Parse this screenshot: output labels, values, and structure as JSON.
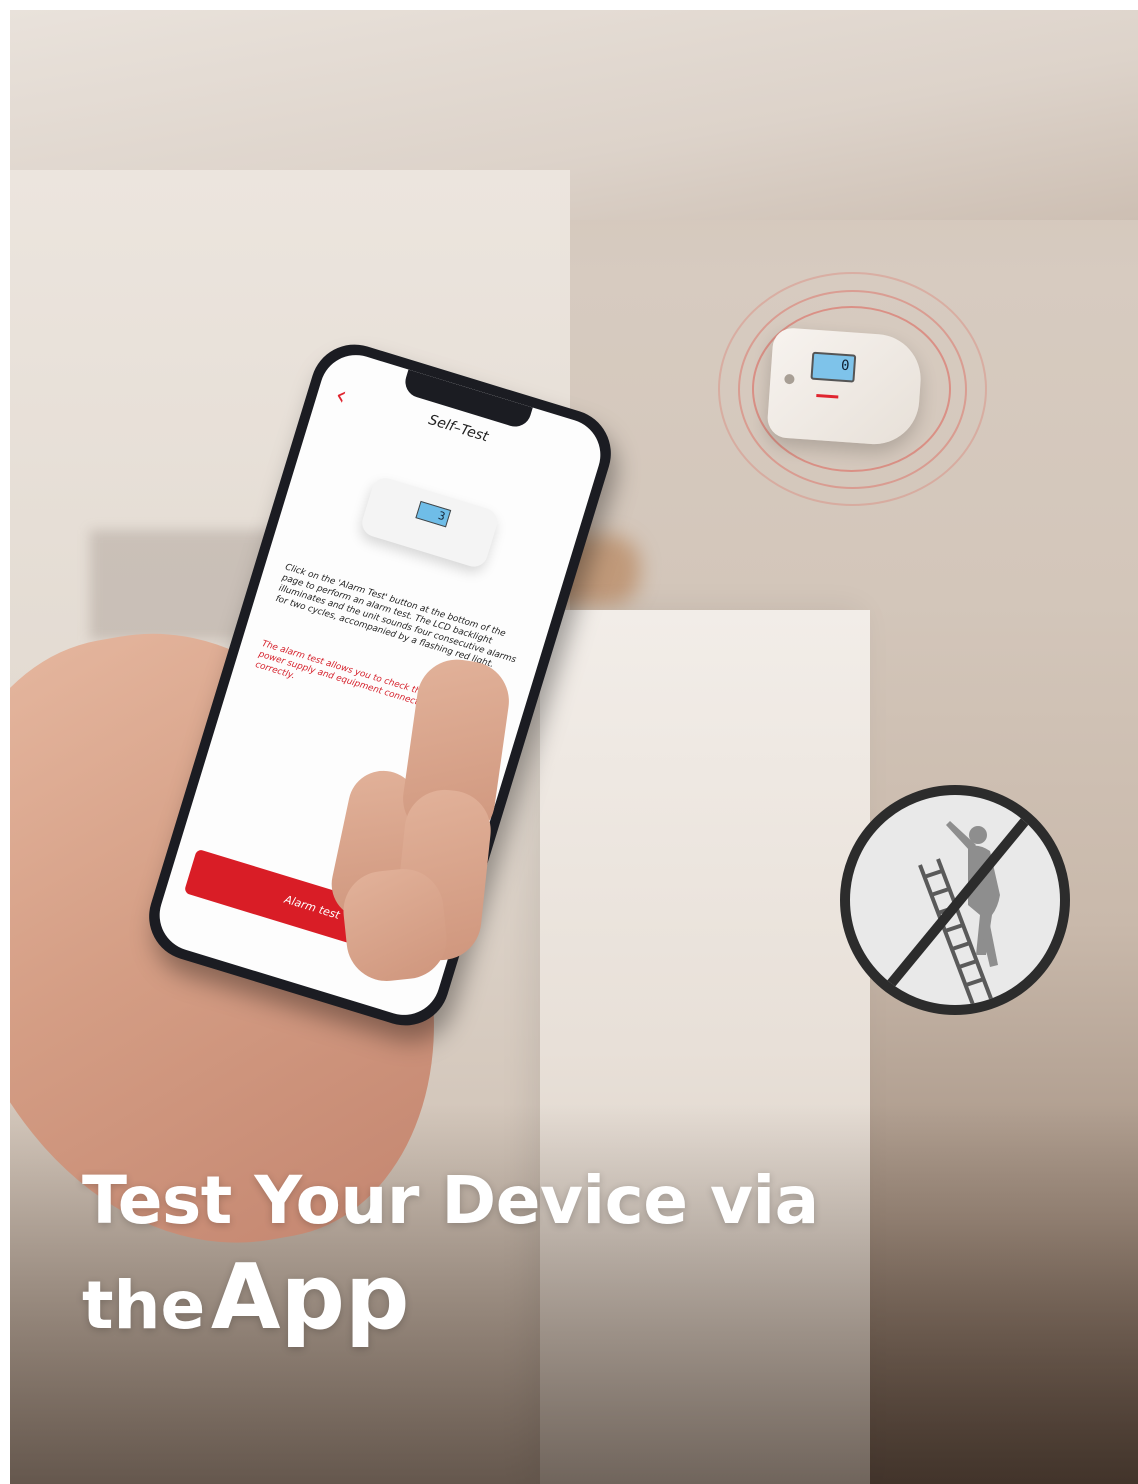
{
  "app_screen": {
    "title": "Self–Test",
    "back_icon": "chevron-left-icon",
    "instruction": "Click on the 'Alarm Test' button at the bottom of the page to perform an alarm test. The LCD backlight illuminates and the unit sounds four consecutive alarms for two cycles, accompanied by a flashing red light.",
    "note": "The alarm test allows you to check that the sensors, power supply and equipment connections are working correctly.",
    "button_label": "Alarm test",
    "accent_color": "#d91d26",
    "device_lcd_value": "3"
  },
  "ceiling_device": {
    "lcd_value": "0"
  },
  "headline": {
    "line1": "Test Your Device via",
    "line2_small": "the",
    "line2_big": "App"
  },
  "icons": [
    "no-ladder-icon",
    "sound-waves-icon",
    "chevron-left-icon"
  ]
}
